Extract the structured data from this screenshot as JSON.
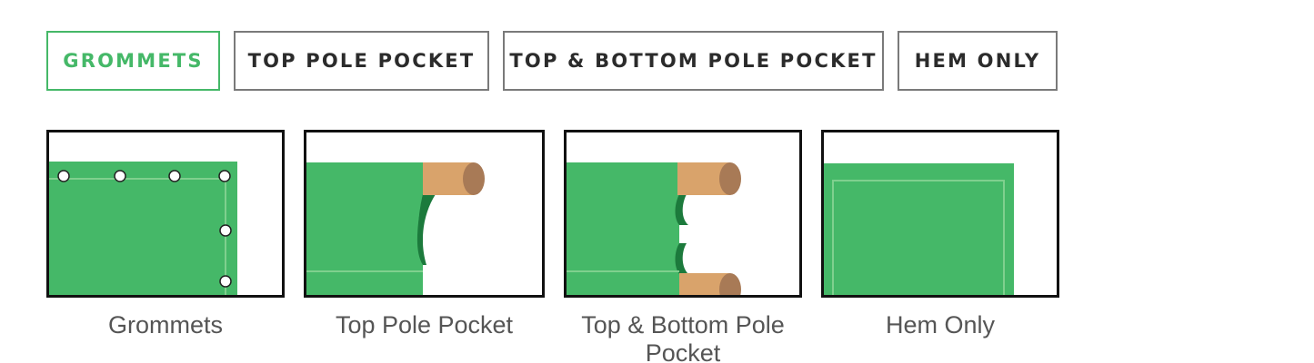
{
  "tabs": [
    {
      "label": "GROMMETS",
      "active": true
    },
    {
      "label": "TOP POLE POCKET",
      "active": false
    },
    {
      "label": "TOP & BOTTOM POLE POCKET",
      "active": false
    },
    {
      "label": "HEM ONLY",
      "active": false
    }
  ],
  "options": [
    {
      "caption": "Grommets",
      "image": "grommets-illustration"
    },
    {
      "caption": "Top Pole Pocket",
      "image": "top-pole-pocket-illustration"
    },
    {
      "caption": "Top & Bottom Pole Pocket",
      "image": "top-bottom-pole-pocket-illustration"
    },
    {
      "caption": "Hem Only",
      "image": "hem-only-illustration"
    }
  ],
  "colors": {
    "accent": "#45b868",
    "banner_green": "#45b868",
    "banner_shadow": "#1c7a3c",
    "pole": "#d9a36b",
    "pole_end": "#a87a56",
    "tab_border": "#7a7a7a",
    "card_border": "#111111",
    "caption_text": "#555555"
  }
}
